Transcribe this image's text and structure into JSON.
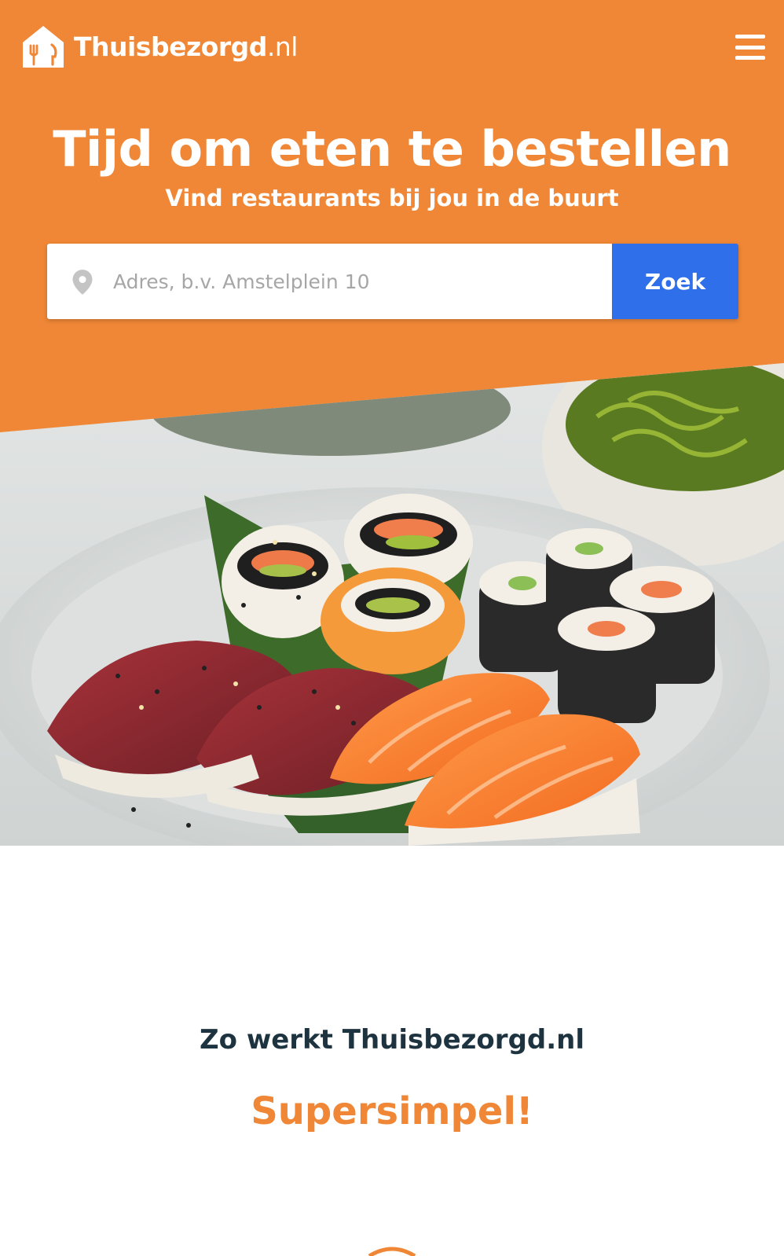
{
  "header": {
    "logo_name": "Thuisbezorgd",
    "logo_tld": ".nl",
    "menu_icon": "hamburger-menu-icon"
  },
  "hero": {
    "title": "Tijd om eten te bestellen",
    "subtitle": "Vind restaurants bij jou in de buurt",
    "hero_image": "sushi-platter-photo"
  },
  "search": {
    "placeholder": "Adres, b.v. Amstelplein 10",
    "value": "",
    "button_label": "Zoek",
    "icon": "location-pin-icon"
  },
  "how_it_works": {
    "intro": "Zo werkt Thuisbezorgd.nl",
    "tagline": "Supersimpel!"
  },
  "colors": {
    "brand_orange": "#ef8736",
    "button_blue": "#2f6fe9",
    "text_dark": "#1d3340"
  }
}
